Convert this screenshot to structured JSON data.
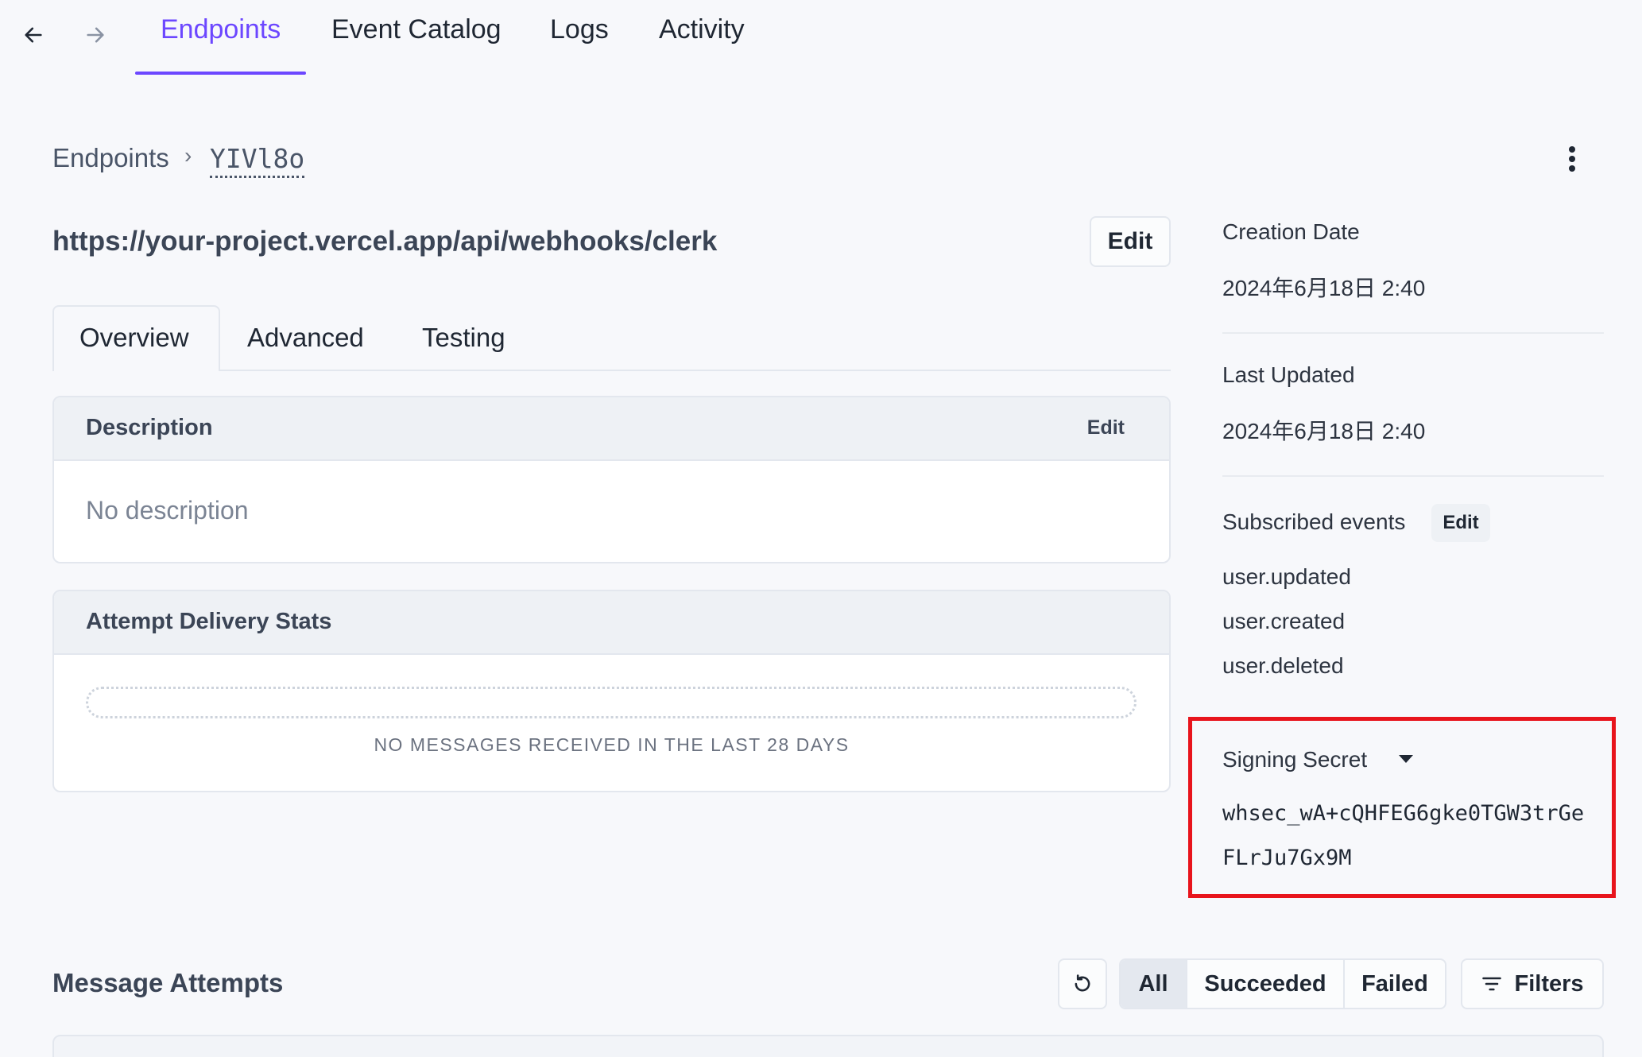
{
  "nav": {
    "back_icon": "arrow-left-icon",
    "forward_icon": "arrow-right-icon",
    "tabs": [
      {
        "label": "Endpoints",
        "active": true
      },
      {
        "label": "Event Catalog",
        "active": false
      },
      {
        "label": "Logs",
        "active": false
      },
      {
        "label": "Activity",
        "active": false
      }
    ],
    "accent_color": "#6c47ff"
  },
  "breadcrumb": {
    "root": "Endpoints",
    "separator": "›",
    "current": "YIVl8o"
  },
  "endpoint": {
    "url": "https://your-project.vercel.app/api/webhooks/clerk",
    "edit_label": "Edit"
  },
  "content_tabs": [
    {
      "label": "Overview",
      "active": true
    },
    {
      "label": "Advanced",
      "active": false
    },
    {
      "label": "Testing",
      "active": false
    }
  ],
  "description_card": {
    "title": "Description",
    "edit_label": "Edit",
    "body": "No description"
  },
  "stats_card": {
    "title": "Attempt Delivery Stats",
    "empty_text": "NO MESSAGES RECEIVED IN THE LAST 28 DAYS"
  },
  "sidebar": {
    "creation_label": "Creation Date",
    "creation_value": "2024年6月18日 2:40",
    "updated_label": "Last Updated",
    "updated_value": "2024年6月18日 2:40",
    "events_label": "Subscribed events",
    "events_edit": "Edit",
    "events": [
      "user.updated",
      "user.created",
      "user.deleted"
    ],
    "secret_label": "Signing Secret",
    "secret_line1": "whsec_wA+cQHFEG6gke0TGW3trGe",
    "secret_line2": "FLrJu7Gx9M",
    "highlight_color": "#e8141c"
  },
  "messages": {
    "title": "Message Attempts",
    "refresh_icon": "refresh-icon",
    "filter_options": [
      "All",
      "Succeeded",
      "Failed"
    ],
    "selected_filter": "All",
    "filters_label": "Filters"
  }
}
